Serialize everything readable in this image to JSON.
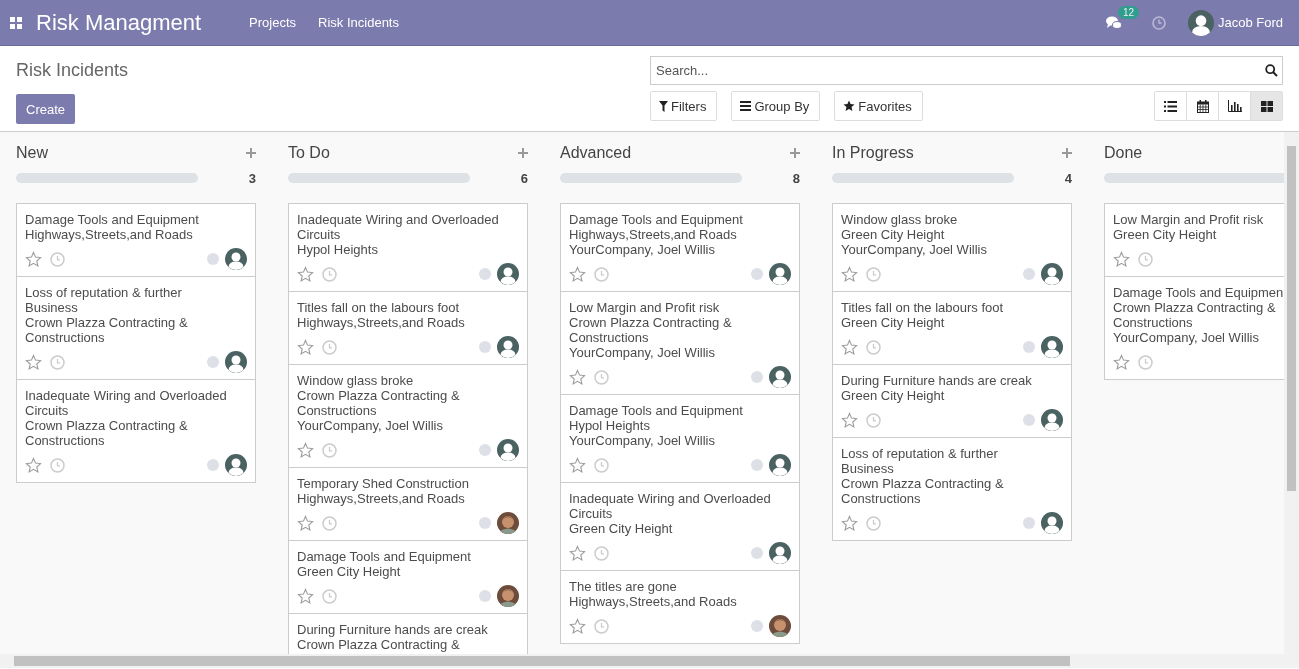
{
  "navbar": {
    "app_title": "Risk Managment",
    "menu": [
      "Projects",
      "Risk Incidents"
    ],
    "messages_badge": "12",
    "user": "Jacob Ford"
  },
  "breadcrumb": "Risk Incidents",
  "create_button": "Create",
  "search": {
    "placeholder": "Search..."
  },
  "filter_buttons": [
    {
      "kind": "filter",
      "label": "Filters"
    },
    {
      "kind": "group",
      "label": "Group By"
    },
    {
      "kind": "favorite",
      "label": "Favorites"
    }
  ],
  "views": [
    {
      "kind": "list",
      "selected": false
    },
    {
      "kind": "calendar",
      "selected": false
    },
    {
      "kind": "graph",
      "selected": false
    },
    {
      "kind": "kanban",
      "selected": true
    }
  ],
  "columns": [
    {
      "title": "New",
      "count": "3",
      "quick_create": true,
      "level": 0,
      "cards": [
        {
          "name": "Damage Tools and Equipment",
          "location": "Highways,Streets,and Roads",
          "avatar": {
            "kind": "silhouette"
          }
        },
        {
          "name": "Loss of reputation & further Business",
          "location": "Crown Plazza Contracting & Constructions",
          "avatar": {
            "kind": "silhouette"
          }
        },
        {
          "name": "Inadequate Wiring and Overloaded Circuits",
          "location": "Crown Plazza Contracting & Constructions",
          "avatar": {
            "kind": "silhouette"
          }
        }
      ]
    },
    {
      "title": "To Do",
      "count": "6",
      "quick_create": true,
      "level": 0,
      "cards": [
        {
          "name": "Inadequate Wiring and Overloaded Circuits",
          "location": "Hypol Heights",
          "avatar": {
            "kind": "silhouette"
          }
        },
        {
          "name": "Titles fall on the labours foot",
          "location": "Highways,Streets,and Roads",
          "avatar": {
            "kind": "silhouette"
          }
        },
        {
          "name": "Window glass broke",
          "location": "Crown Plazza Contracting & Constructions",
          "assignee": "YourCompany, Joel Willis",
          "avatar": {
            "kind": "silhouette"
          }
        },
        {
          "name": "Temporary Shed Construction",
          "location": "Highways,Streets,and Roads",
          "avatar": {
            "kind": "photo"
          }
        },
        {
          "name": "Damage Tools and Equipment",
          "location": "Green City Height",
          "avatar": {
            "kind": "photo"
          }
        },
        {
          "name": "During Furniture hands are creak",
          "location": "Crown Plazza Contracting &"
        }
      ]
    },
    {
      "title": "Advanced",
      "count": "8",
      "quick_create": true,
      "level": 0,
      "cards": [
        {
          "name": "Damage Tools and Equipment",
          "location": "Highways,Streets,and Roads",
          "assignee": "YourCompany, Joel Willis",
          "avatar": {
            "kind": "silhouette"
          }
        },
        {
          "name": "Low Margin and Profit risk",
          "location": "Crown Plazza Contracting & Constructions",
          "assignee": "YourCompany, Joel Willis",
          "avatar": {
            "kind": "silhouette"
          }
        },
        {
          "name": "Damage Tools and Equipment",
          "location": "Hypol Heights",
          "assignee": "YourCompany, Joel Willis",
          "avatar": {
            "kind": "silhouette"
          }
        },
        {
          "name": "Inadequate Wiring and Overloaded Circuits",
          "location": "Green City Height",
          "avatar": {
            "kind": "silhouette"
          }
        },
        {
          "name": "The titles are gone",
          "location": "Highways,Streets,and Roads",
          "avatar": {
            "kind": "photo"
          }
        }
      ]
    },
    {
      "title": "In Progress",
      "count": "4",
      "quick_create": true,
      "level": 0,
      "cards": [
        {
          "name": "Window glass broke",
          "location": "Green City Height",
          "assignee": "YourCompany, Joel Willis",
          "avatar": {
            "kind": "silhouette"
          }
        },
        {
          "name": "Titles fall on the labours foot",
          "location": "Green City Height",
          "avatar": {
            "kind": "silhouette"
          }
        },
        {
          "name": "During Furniture hands are creak",
          "location": "Green City Height",
          "avatar": {
            "kind": "silhouette"
          }
        },
        {
          "name": "Loss of reputation & further Business",
          "location": "Crown Plazza Contracting & Constructions",
          "avatar": {
            "kind": "silhouette"
          }
        }
      ]
    },
    {
      "title": "Done",
      "quick_create": false,
      "level": 0,
      "cards": [
        {
          "name": "Low Margin and Profit risk",
          "location": "Green City Height"
        },
        {
          "name": "Damage Tools and Equipmen",
          "location": "Crown Plazza Contracting & Constructions",
          "assignee": "YourCompany, Joel Willis"
        }
      ]
    }
  ]
}
